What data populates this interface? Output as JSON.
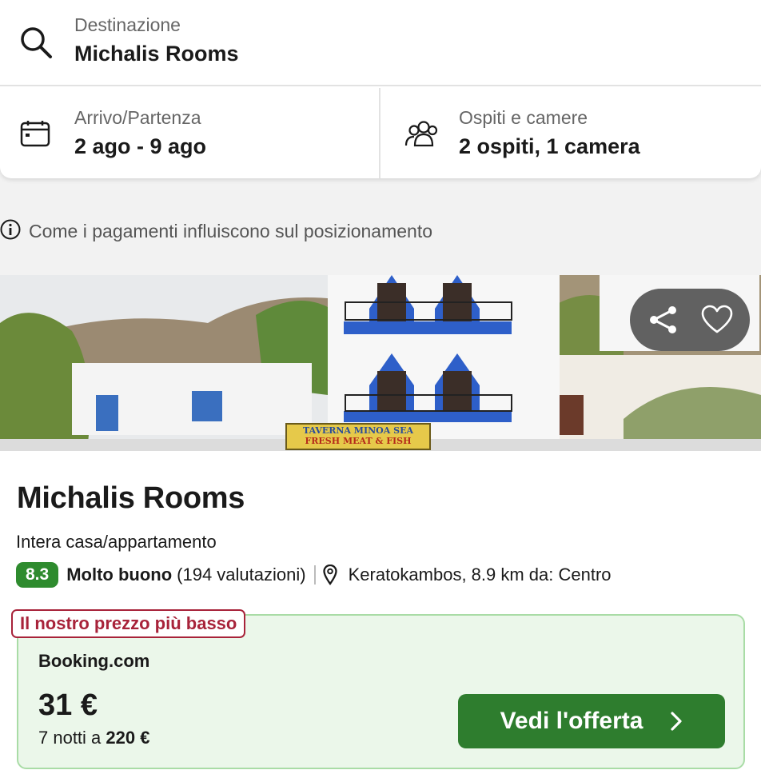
{
  "search": {
    "destination": {
      "label": "Destinazione",
      "value": "Michalis Rooms"
    },
    "dates": {
      "label": "Arrivo/Partenza",
      "value": "2 ago - 9 ago"
    },
    "guests": {
      "label": "Ospiti e camere",
      "value": "2 ospiti, 1 camera"
    }
  },
  "info_notice": "Come i pagamenti influiscono sul posizionamento",
  "image": {
    "sign_line1": "TAVERNA MINOA SEA",
    "sign_line2": "FRESH MEAT & FISH"
  },
  "hotel": {
    "name": "Michalis Rooms",
    "type": "Intera casa/appartamento",
    "rating_score": "8.3",
    "rating_text": "Molto buono",
    "rating_count": "(194 valutazioni)",
    "location": "Keratokambos, 8.9 km da: Centro"
  },
  "deal": {
    "tag": "Il nostro prezzo più basso",
    "provider": "Booking.com",
    "price": "31 €",
    "nights_prefix": "7 notti a",
    "nights_total": "220 €",
    "cta_label": "Vedi l'offerta"
  },
  "colors": {
    "rating_green": "#2e8b2e",
    "cta_green": "#2e7d2e",
    "deal_bg": "#ebf7ea",
    "tag_red": "#a8233a"
  }
}
